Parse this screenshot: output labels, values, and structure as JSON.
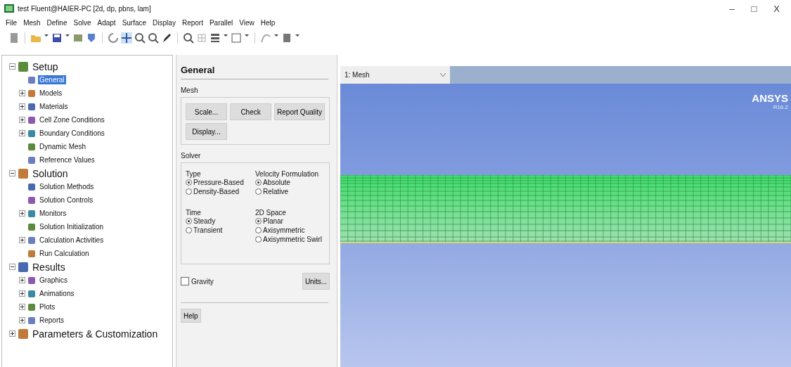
{
  "window": {
    "title": "test Fluent@HAIER-PC  [2d, dp, pbns, lam]",
    "controls": [
      "–",
      "□",
      "X"
    ]
  },
  "menu": [
    "File",
    "Mesh",
    "Define",
    "Solve",
    "Adapt",
    "Surface",
    "Display",
    "Report",
    "Parallel",
    "View",
    "Help"
  ],
  "tree": [
    {
      "label": "Setup",
      "expanded": true,
      "selected": false,
      "children": [
        {
          "label": "General",
          "selected": true
        },
        {
          "label": "Models",
          "expanded": false,
          "selected": false
        },
        {
          "label": "Materials",
          "expanded": false,
          "selected": false
        },
        {
          "label": "Cell Zone Conditions",
          "expanded": false,
          "selected": false
        },
        {
          "label": "Boundary Conditions",
          "expanded": false,
          "selected": false
        },
        {
          "label": "Dynamic Mesh",
          "selected": false
        },
        {
          "label": "Reference Values",
          "selected": false
        }
      ]
    },
    {
      "label": "Solution",
      "expanded": true,
      "selected": false,
      "children": [
        {
          "label": "Solution Methods",
          "selected": false
        },
        {
          "label": "Solution Controls",
          "selected": false
        },
        {
          "label": "Monitors",
          "expanded": false,
          "selected": false
        },
        {
          "label": "Solution Initialization",
          "selected": false
        },
        {
          "label": "Calculation Activities",
          "expanded": false,
          "selected": false
        },
        {
          "label": "Run Calculation",
          "selected": false
        }
      ]
    },
    {
      "label": "Results",
      "expanded": true,
      "selected": false,
      "children": [
        {
          "label": "Graphics",
          "expanded": false,
          "selected": false
        },
        {
          "label": "Animations",
          "expanded": false,
          "selected": false
        },
        {
          "label": "Plots",
          "expanded": false,
          "selected": false
        },
        {
          "label": "Reports",
          "expanded": false,
          "selected": false
        }
      ]
    },
    {
      "label": "Parameters & Customization",
      "expanded": false,
      "selected": false
    }
  ],
  "panel": {
    "title": "General",
    "mesh": {
      "label": "Mesh",
      "buttons": [
        "Scale...",
        "Check",
        "Report Quality",
        "Display..."
      ]
    },
    "solver": {
      "label": "Solver",
      "groups": [
        {
          "label": "Type",
          "options": [
            {
              "label": "Pressure-Based",
              "selected": true
            },
            {
              "label": "Density-Based",
              "selected": false
            }
          ]
        },
        {
          "label": "Velocity Formulation",
          "options": [
            {
              "label": "Absolute",
              "selected": true
            },
            {
              "label": "Relative",
              "selected": false
            }
          ]
        },
        {
          "label": "Time",
          "options": [
            {
              "label": "Steady",
              "selected": true
            },
            {
              "label": "Transient",
              "selected": false
            }
          ]
        },
        {
          "label": "2D Space",
          "options": [
            {
              "label": "Planar",
              "selected": true
            },
            {
              "label": "Axisymmetric",
              "selected": false
            },
            {
              "label": "Axisymmetric Swirl",
              "selected": false
            }
          ]
        }
      ]
    },
    "gravity": {
      "label": "Gravity",
      "checked": false
    },
    "units_button": "Units...",
    "help_button": "Help"
  },
  "graphics": {
    "view_select": "1: Mesh",
    "logo": "ANSYS",
    "version": "R16.2"
  }
}
